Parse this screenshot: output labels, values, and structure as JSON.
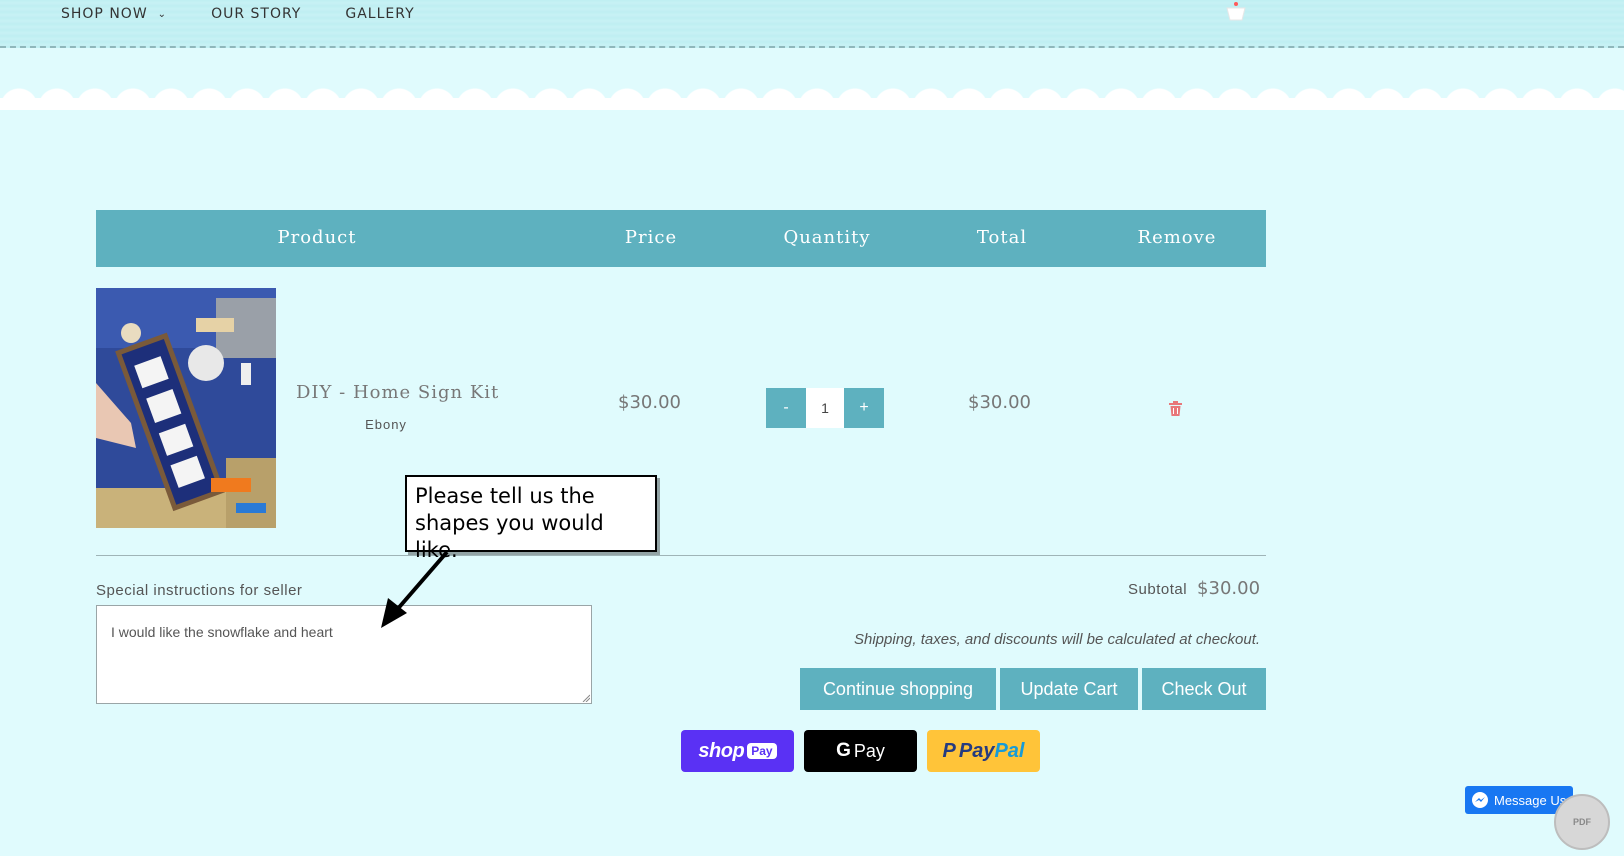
{
  "nav": {
    "shop_now": "SHOP NOW",
    "our_story": "OUR STORY",
    "gallery": "GALLERY"
  },
  "cart_table": {
    "headers": [
      "Product",
      "Price",
      "Quantity",
      "Total",
      "Remove"
    ]
  },
  "item": {
    "name": "DIY - Home Sign Kit",
    "variant": "Ebony",
    "price": "$30.00",
    "quantity": "1",
    "total": "$30.00",
    "decrement": "-",
    "increment": "+"
  },
  "instructions": {
    "label": "Special instructions for seller",
    "value": "I would like the snowflake and heart"
  },
  "summary": {
    "subtotal_label": "Subtotal",
    "subtotal_value": "$30.00",
    "note": "Shipping, taxes, and discounts will be calculated at checkout."
  },
  "buttons": {
    "continue": "Continue shopping",
    "update": "Update Cart",
    "checkout": "Check Out"
  },
  "payments": {
    "shop_word": "shop",
    "shop_badge": "Pay",
    "google_g": "G",
    "google_pay": "Pay",
    "paypal_p": "P",
    "paypal_pay": "Pay",
    "paypal_pal": "Pal"
  },
  "callout": {
    "line1": "Please tell us the",
    "line2": "shapes you would like."
  },
  "widgets": {
    "messenger_label": "Message Us",
    "pdf_badge": "PDF"
  },
  "colors": {
    "page_bg": "#e0fbfd",
    "accent": "#5eb1bf",
    "shop_pay": "#5a31f4",
    "paypal": "#ffc439",
    "messenger": "#1877f2",
    "trash": "#e8777a"
  }
}
